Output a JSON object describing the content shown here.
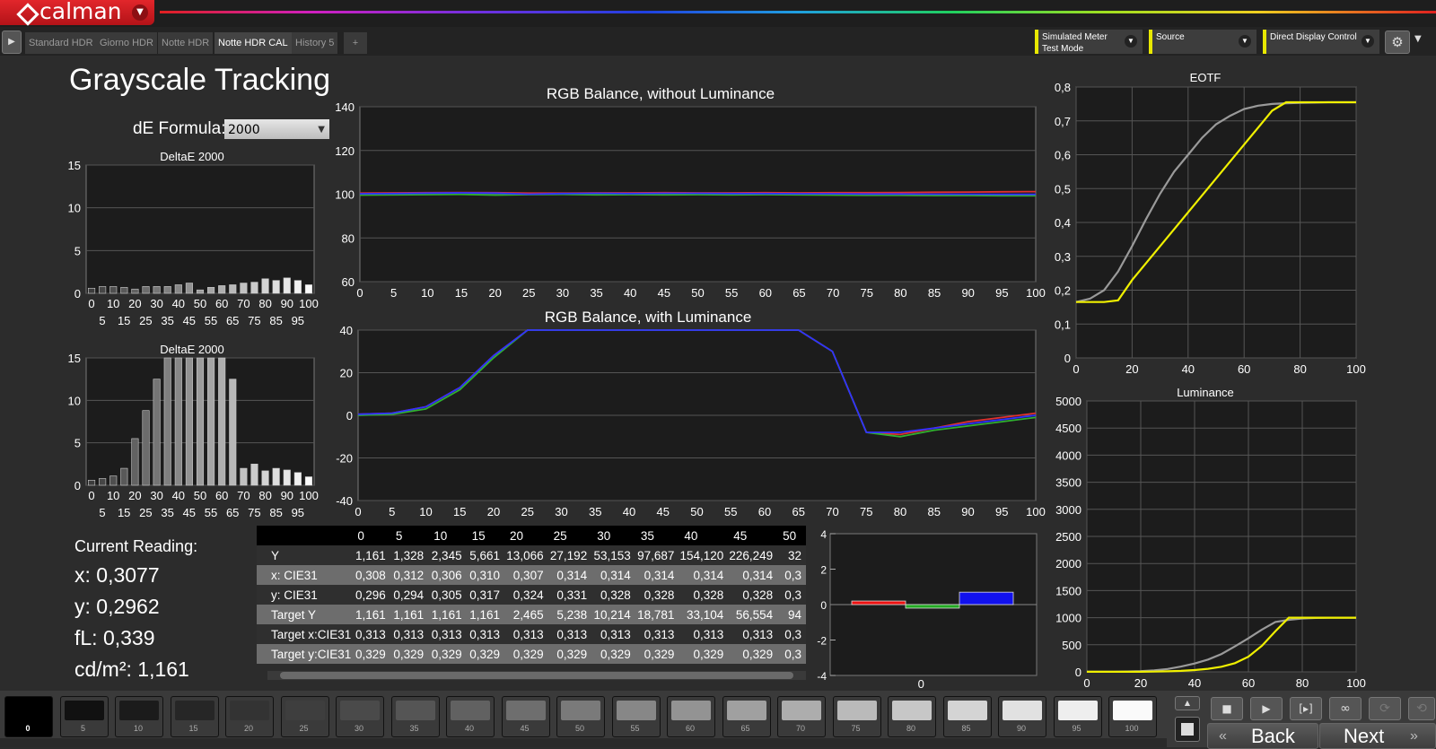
{
  "app": {
    "name": "calman"
  },
  "tabs": [
    {
      "label": "Standard HDR",
      "active": false
    },
    {
      "label": "Giorno HDR",
      "active": false
    },
    {
      "label": "Notte HDR",
      "active": false
    },
    {
      "label": "Notte HDR CAL",
      "active": true
    },
    {
      "label": "History 5",
      "active": false
    }
  ],
  "add_tab_label": "+",
  "controls": {
    "meter": {
      "line1": "Simulated Meter",
      "line2": "Test Mode"
    },
    "source": {
      "line1": "Source"
    },
    "display": {
      "line1": "Direct Display Control"
    }
  },
  "accent_color": "#e8e800",
  "brand_color": "#d81f26",
  "page": {
    "title": "Grayscale Tracking",
    "de_formula_label": "dE Formula:",
    "de_formula_value": "2000"
  },
  "current_reading": {
    "heading": "Current Reading:",
    "x": "x: 0,3077",
    "y": "y: 0,2962",
    "fl": "fL: 0,339",
    "cdm2": "cd/m²: 1,161"
  },
  "chart_data": [
    {
      "id": "deltaE_top",
      "type": "bar",
      "title": "DeltaE 2000",
      "categories": [
        0,
        5,
        10,
        15,
        20,
        25,
        30,
        35,
        40,
        45,
        50,
        55,
        60,
        65,
        70,
        75,
        80,
        85,
        90,
        95,
        100
      ],
      "values": [
        0.6,
        0.8,
        0.8,
        0.7,
        0.5,
        0.8,
        0.8,
        0.8,
        1.0,
        1.2,
        0.4,
        0.7,
        0.9,
        1.0,
        1.2,
        1.3,
        1.7,
        1.5,
        1.8,
        1.5,
        1.0
      ],
      "ylim": [
        0,
        15
      ],
      "yticks": [
        0,
        5,
        10,
        15
      ],
      "xticks_top": [
        "0",
        "10",
        "20",
        "30",
        "40",
        "50",
        "60",
        "70",
        "80",
        "90",
        "100"
      ],
      "xticks_bottom": [
        "5",
        "15",
        "25",
        "35",
        "45",
        "55",
        "65",
        "75",
        "85",
        "95"
      ]
    },
    {
      "id": "deltaE_bottom",
      "type": "bar",
      "title": "DeltaE 2000",
      "categories": [
        0,
        5,
        10,
        15,
        20,
        25,
        30,
        35,
        40,
        45,
        50,
        55,
        60,
        65,
        70,
        75,
        80,
        85,
        90,
        95,
        100
      ],
      "values": [
        0.6,
        0.8,
        1.1,
        2.0,
        5.5,
        8.8,
        12.5,
        16,
        16,
        16,
        16,
        16,
        16,
        12.5,
        2.0,
        2.5,
        1.7,
        2.0,
        1.8,
        1.5,
        1.0
      ],
      "ylim": [
        0,
        15
      ],
      "yticks": [
        0,
        5,
        10,
        15
      ],
      "xticks_top": [
        "0",
        "10",
        "20",
        "30",
        "40",
        "50",
        "60",
        "70",
        "80",
        "90",
        "100"
      ],
      "xticks_bottom": [
        "5",
        "15",
        "25",
        "35",
        "45",
        "55",
        "65",
        "75",
        "85",
        "95"
      ]
    },
    {
      "id": "rgb_without_lum",
      "type": "line",
      "title": "RGB Balance, without Luminance",
      "x": [
        0,
        5,
        10,
        15,
        20,
        25,
        30,
        35,
        40,
        45,
        50,
        55,
        60,
        65,
        70,
        75,
        80,
        85,
        90,
        95,
        100
      ],
      "ylim": [
        60,
        140
      ],
      "yticks": [
        "60",
        "80",
        "100",
        "120",
        "140"
      ],
      "xticks": [
        "0",
        "5",
        "10",
        "15",
        "20",
        "25",
        "30",
        "35",
        "40",
        "45",
        "50",
        "55",
        "60",
        "65",
        "70",
        "75",
        "80",
        "85",
        "90",
        "95",
        "100"
      ],
      "series": [
        {
          "color": "#e03030",
          "values": [
            100.5,
            100.6,
            100.7,
            100.8,
            100.7,
            100.5,
            100.5,
            100.6,
            100.6,
            100.7,
            100.6,
            100.6,
            100.7,
            100.6,
            100.7,
            100.7,
            100.8,
            100.9,
            101,
            101.1,
            101.2
          ]
        },
        {
          "color": "#30b030",
          "values": [
            99.6,
            99.7,
            99.8,
            99.9,
            99.6,
            99.8,
            99.9,
            99.7,
            99.8,
            99.7,
            99.8,
            99.7,
            99.8,
            99.7,
            99.6,
            99.5,
            99.5,
            99.4,
            99.4,
            99.3,
            99.3
          ]
        },
        {
          "color": "#3030ff",
          "values": [
            100.2,
            100.3,
            100.5,
            100.6,
            100.5,
            100,
            100.3,
            100.4,
            100.3,
            100.4,
            100.4,
            100.3,
            100.3,
            100.2,
            100.2,
            100.1,
            100.1,
            100,
            100,
            99.9,
            99.9
          ]
        }
      ]
    },
    {
      "id": "rgb_with_lum",
      "type": "line",
      "title": "RGB Balance, with Luminance",
      "x": [
        0,
        5,
        10,
        15,
        20,
        25,
        30,
        35,
        40,
        45,
        50,
        55,
        60,
        65,
        70,
        75,
        80,
        85,
        90,
        95,
        100
      ],
      "ylim": [
        -40,
        40
      ],
      "yticks": [
        "-40",
        "-20",
        "0",
        "20",
        "40"
      ],
      "xticks": [
        "0",
        "5",
        "10",
        "15",
        "20",
        "25",
        "30",
        "35",
        "40",
        "45",
        "50",
        "55",
        "60",
        "65",
        "70",
        "75",
        "80",
        "85",
        "90",
        "95",
        "100"
      ],
      "series": [
        {
          "color": "#e03030",
          "values": [
            0.5,
            1,
            4,
            13,
            28,
            40,
            40,
            40,
            40,
            40,
            40,
            40,
            40,
            40,
            30,
            -8,
            -9,
            -6,
            -3,
            -1,
            1
          ]
        },
        {
          "color": "#30b030",
          "values": [
            0,
            0.5,
            3,
            12,
            27,
            40,
            40,
            40,
            40,
            40,
            40,
            40,
            40,
            40,
            30,
            -8,
            -10,
            -7,
            -5,
            -3,
            -1
          ]
        },
        {
          "color": "#3030ff",
          "values": [
            0.5,
            1,
            4,
            13,
            28,
            40,
            40,
            40,
            40,
            40,
            40,
            40,
            40,
            40,
            30,
            -8,
            -8,
            -6,
            -4,
            -2,
            0
          ]
        }
      ]
    },
    {
      "id": "eotf",
      "type": "line",
      "title": "EOTF",
      "x": [
        0,
        5,
        10,
        15,
        20,
        25,
        30,
        35,
        40,
        45,
        50,
        55,
        60,
        65,
        70,
        75,
        80,
        85,
        90,
        95,
        100
      ],
      "xlim": [
        0,
        100
      ],
      "ylim": [
        0,
        0.8
      ],
      "yticks": [
        "0",
        "0,1",
        "0,2",
        "0,3",
        "0,4",
        "0,5",
        "0,6",
        "0,7",
        "0,8"
      ],
      "xticks": [
        "0",
        "20",
        "40",
        "60",
        "80",
        "100"
      ],
      "series": [
        {
          "color": "#9a9a9a",
          "values": [
            0.165,
            0.175,
            0.2,
            0.255,
            0.33,
            0.41,
            0.485,
            0.55,
            0.6,
            0.65,
            0.69,
            0.715,
            0.735,
            0.745,
            0.75,
            0.752,
            0.753,
            0.754,
            0.755,
            0.755,
            0.755
          ]
        },
        {
          "color": "#f0f000",
          "values": [
            0.165,
            0.165,
            0.165,
            0.17,
            0.23,
            0.28,
            0.33,
            0.38,
            0.43,
            0.48,
            0.53,
            0.58,
            0.63,
            0.68,
            0.73,
            0.755,
            0.755,
            0.755,
            0.755,
            0.755,
            0.755
          ]
        }
      ]
    },
    {
      "id": "luminance",
      "type": "line",
      "title": "Luminance",
      "x": [
        0,
        5,
        10,
        15,
        20,
        25,
        30,
        35,
        40,
        45,
        50,
        55,
        60,
        65,
        70,
        75,
        80,
        85,
        90,
        95,
        100
      ],
      "xlim": [
        0,
        100
      ],
      "ylim": [
        0,
        5000
      ],
      "yticks": [
        "0",
        "500",
        "1000",
        "1500",
        "2000",
        "2500",
        "3000",
        "3500",
        "4000",
        "4500",
        "5000"
      ],
      "xticks": [
        "0",
        "20",
        "40",
        "60",
        "80",
        "100"
      ],
      "series": [
        {
          "color": "#9a9a9a",
          "values": [
            1,
            1,
            2,
            6,
            13,
            27,
            53,
            98,
            154,
            226,
            330,
            470,
            620,
            780,
            920,
            960,
            985,
            995,
            1000,
            1000,
            1000
          ]
        },
        {
          "color": "#f0f000",
          "values": [
            1,
            1,
            1,
            1,
            2,
            5,
            10,
            19,
            33,
            57,
            95,
            160,
            280,
            480,
            750,
            1000,
            1000,
            1000,
            1000,
            1000,
            1000
          ]
        }
      ]
    },
    {
      "id": "rgb_delta_bar",
      "type": "bar",
      "ylim": [
        -4,
        4
      ],
      "yticks": [
        "-4",
        "-2",
        "0",
        "2",
        "4"
      ],
      "xtick": "0",
      "series": [
        {
          "color": "#ee1111",
          "value": 0.2
        },
        {
          "color": "#22aa22",
          "value": -0.2
        },
        {
          "color": "#1111ee",
          "value": 0.7
        }
      ]
    }
  ],
  "table": {
    "columns": [
      "0",
      "5",
      "10",
      "15",
      "20",
      "25",
      "30",
      "35",
      "40",
      "45",
      "50"
    ],
    "rows": [
      {
        "label": "Y",
        "values": [
          "1,161",
          "1,328",
          "2,345",
          "5,661",
          "13,066",
          "27,192",
          "53,153",
          "97,687",
          "154,120",
          "226,249",
          "32"
        ]
      },
      {
        "label": "x: CIE31",
        "values": [
          "0,308",
          "0,312",
          "0,306",
          "0,310",
          "0,307",
          "0,314",
          "0,314",
          "0,314",
          "0,314",
          "0,314",
          "0,3"
        ]
      },
      {
        "label": "y: CIE31",
        "values": [
          "0,296",
          "0,294",
          "0,305",
          "0,317",
          "0,324",
          "0,331",
          "0,328",
          "0,328",
          "0,328",
          "0,328",
          "0,3"
        ]
      },
      {
        "label": "Target Y",
        "values": [
          "1,161",
          "1,161",
          "1,161",
          "1,161",
          "2,465",
          "5,238",
          "10,214",
          "18,781",
          "33,104",
          "56,554",
          "94"
        ]
      },
      {
        "label": "Target x:CIE31",
        "values": [
          "0,313",
          "0,313",
          "0,313",
          "0,313",
          "0,313",
          "0,313",
          "0,313",
          "0,313",
          "0,313",
          "0,313",
          "0,3"
        ]
      },
      {
        "label": "Target y:CIE31",
        "values": [
          "0,329",
          "0,329",
          "0,329",
          "0,329",
          "0,329",
          "0,329",
          "0,329",
          "0,329",
          "0,329",
          "0,329",
          "0,3"
        ]
      }
    ]
  },
  "swatches": [
    {
      "label": "0",
      "color": "#000000"
    },
    {
      "label": "5",
      "color": "#111111"
    },
    {
      "label": "10",
      "color": "#1b1b1b"
    },
    {
      "label": "15",
      "color": "#262626"
    },
    {
      "label": "20",
      "color": "#333333"
    },
    {
      "label": "25",
      "color": "#3e3e3e"
    },
    {
      "label": "30",
      "color": "#4a4a4a"
    },
    {
      "label": "35",
      "color": "#555555"
    },
    {
      "label": "40",
      "color": "#616161"
    },
    {
      "label": "45",
      "color": "#6e6e6e"
    },
    {
      "label": "50",
      "color": "#7a7a7a"
    },
    {
      "label": "55",
      "color": "#878787"
    },
    {
      "label": "60",
      "color": "#939393"
    },
    {
      "label": "65",
      "color": "#a0a0a0"
    },
    {
      "label": "70",
      "color": "#adadad"
    },
    {
      "label": "75",
      "color": "#bababa"
    },
    {
      "label": "80",
      "color": "#c7c7c7"
    },
    {
      "label": "85",
      "color": "#d4d4d4"
    },
    {
      "label": "90",
      "color": "#e1e1e1"
    },
    {
      "label": "95",
      "color": "#eeeeee"
    },
    {
      "label": "100",
      "color": "#fafafa"
    }
  ],
  "nav": {
    "back_label": "Back",
    "next_label": "Next"
  },
  "icons": {
    "play": "play-icon",
    "stop": "stop-icon",
    "loop": "loop-icon",
    "refresh": "refresh-icon",
    "settings": "gear-icon",
    "record": "record-icon"
  }
}
